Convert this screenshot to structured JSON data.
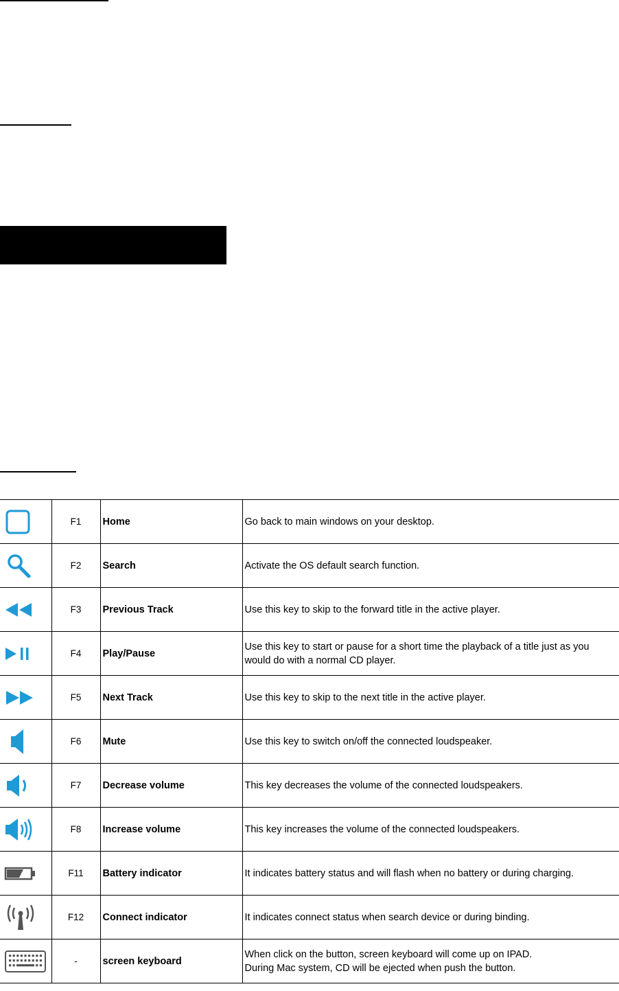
{
  "colors": {
    "icon": "#1e9ad6",
    "icon_gray": "#555555",
    "rule": "#000000"
  },
  "rows": [
    {
      "icon": "home-square-icon",
      "key": "F1",
      "function": "Home",
      "description_lines": [
        "Go back to main windows on your desktop."
      ]
    },
    {
      "icon": "search-icon",
      "key": "F2",
      "function": "Search",
      "description_lines": [
        "Activate the OS default search function."
      ]
    },
    {
      "icon": "rewind-icon",
      "key": "F3",
      "function": "Previous Track",
      "description_lines": [
        "Use this key to skip to the forward title in the active player."
      ]
    },
    {
      "icon": "play-pause-icon",
      "key": "F4",
      "function": "Play/Pause",
      "description_lines": [
        "Use this key to start or pause for a short time the playback of a title just as you would do with a normal CD player."
      ]
    },
    {
      "icon": "fast-forward-icon",
      "key": "F5",
      "function": "Next Track",
      "description_lines": [
        "Use this key to skip to the next title in the active player."
      ]
    },
    {
      "icon": "mute-speaker-icon",
      "key": "F6",
      "function": "Mute",
      "description_lines": [
        "Use this key to switch on/off the connected loudspeaker."
      ]
    },
    {
      "icon": "volume-down-icon",
      "key": "F7",
      "function": "Decrease volume",
      "description_lines": [
        "This key decreases the volume of the connected loudspeakers."
      ]
    },
    {
      "icon": "volume-up-icon",
      "key": "F8",
      "function": "Increase volume",
      "description_lines": [
        "This key increases the volume of the connected loudspeakers."
      ]
    },
    {
      "icon": "battery-icon",
      "key": "F11",
      "function": "Battery indicator",
      "description_lines": [
        "It indicates battery status and will flash when no battery or during charging."
      ]
    },
    {
      "icon": "antenna-icon",
      "key": "F12",
      "function": "Connect indicator",
      "description_lines": [
        "It indicates connect status when search device or during binding."
      ]
    },
    {
      "icon": "keyboard-icon",
      "key": "-",
      "function": "screen keyboard",
      "description_lines": [
        "When click on the button, screen keyboard will come up on IPAD.",
        "During Mac system, CD will be ejected when push the button."
      ]
    }
  ]
}
